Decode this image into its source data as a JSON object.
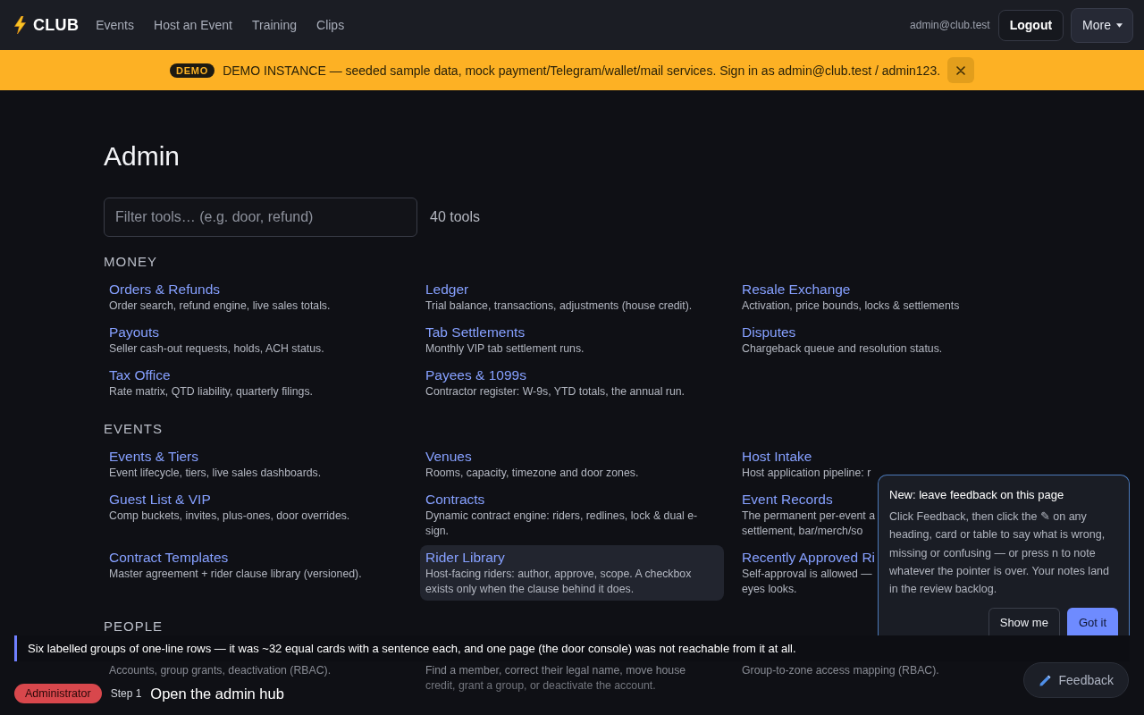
{
  "header": {
    "brand": "CLUB",
    "nav": [
      {
        "label": "Events"
      },
      {
        "label": "Host an Event"
      },
      {
        "label": "Training"
      },
      {
        "label": "Clips"
      }
    ],
    "user_email": "admin@club.test",
    "logout_button": "Logout",
    "more_button": "More"
  },
  "banner": {
    "badge": "DEMO",
    "message": "DEMO INSTANCE — seeded sample data, mock payment/Telegram/wallet/mail services. Sign in as admin@club.test / admin123."
  },
  "page": {
    "title": "Admin",
    "filter": {
      "placeholder": "Filter tools… (e.g. door, refund)"
    },
    "tool_count": "40 tools"
  },
  "sections": [
    {
      "heading": "MONEY",
      "tools": [
        {
          "title": "Orders & Refunds",
          "description": "Order search, refund engine, live sales totals.",
          "hovered": false
        },
        {
          "title": "Ledger",
          "description": "Trial balance, transactions, adjustments (house credit).",
          "hovered": false
        },
        {
          "title": "Resale Exchange",
          "description": "Activation, price bounds, locks & settlements",
          "hovered": false
        },
        {
          "title": "Payouts",
          "description": "Seller cash-out requests, holds, ACH status.",
          "hovered": false
        },
        {
          "title": "Tab Settlements",
          "description": "Monthly VIP tab settlement runs.",
          "hovered": false
        },
        {
          "title": "Disputes",
          "description": "Chargeback queue and resolution status.",
          "hovered": false
        },
        {
          "title": "Tax Office",
          "description": "Rate matrix, QTD liability, quarterly filings.",
          "hovered": false
        },
        {
          "title": "Payees & 1099s",
          "description": "Contractor register: W-9s, YTD totals, the annual run.",
          "hovered": false
        }
      ]
    },
    {
      "heading": "EVENTS",
      "tools": [
        {
          "title": "Events & Tiers",
          "description": "Event lifecycle, tiers, live sales dashboards.",
          "hovered": false
        },
        {
          "title": "Venues",
          "description": "Rooms, capacity, timezone and door zones.",
          "hovered": false
        },
        {
          "title": "Host Intake",
          "description": "Host application pipeline: r",
          "hovered": false
        },
        {
          "title": "Guest List & VIP",
          "description": "Comp buckets, invites, plus-ones, door overrides.",
          "hovered": false
        },
        {
          "title": "Contracts",
          "description": "Dynamic contract engine: riders, redlines, lock & dual e-sign.",
          "hovered": false
        },
        {
          "title": "Event Records",
          "description": "The permanent per-event a\nsettlement, bar/merch/so",
          "hovered": false
        },
        {
          "title": "Contract Templates",
          "description": "Master agreement + rider clause library (versioned).",
          "hovered": false
        },
        {
          "title": "Rider Library",
          "description": "Host-facing riders: author, approve, scope. A checkbox exists only when the clause behind it does.",
          "hovered": true
        },
        {
          "title": "Recently Approved Ri",
          "description": "Self-approval is allowed —\neyes looks.",
          "hovered": false
        }
      ]
    },
    {
      "heading": "PEOPLE",
      "tools": [
        {
          "description": "Accounts, group grants, deactivation (RBAC).",
          "hovered": false
        },
        {
          "description": "Find a member, correct their legal name, move house credit, grant a group, or deactivate the account.",
          "hovered": false
        },
        {
          "description": "Group-to-zone access mapping (RBAC).",
          "hovered": false
        }
      ]
    }
  ],
  "feedback_tip": {
    "title": "New: leave feedback on this page",
    "body": "Click Feedback, then click the ✎ on any heading, card or table to say what is wrong, missing or confusing — or press n to note whatever the pointer is over. Your notes land in the review backlog.",
    "buttons": [
      {
        "label": "Show me",
        "kind": "secondary"
      },
      {
        "label": "Got it",
        "kind": "primary"
      }
    ]
  },
  "caption": "Six labelled groups of one-line rows — it was ~32 equal cards with a sentence each, and one page (the door console) was not reachable from it at all.",
  "step_bar": {
    "role": "Administrator",
    "step": "Step 1",
    "title": "Open the admin hub"
  },
  "feedback_button": "Feedback"
}
